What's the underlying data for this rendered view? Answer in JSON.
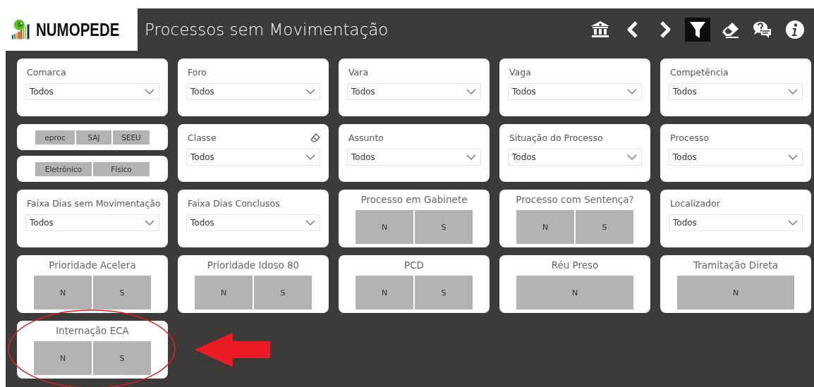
{
  "header": {
    "logo": "NUMOPEDE",
    "title": "Processos sem Movimentação",
    "toolbar": [
      {
        "kind": "bank",
        "selected": false
      },
      {
        "kind": "back",
        "selected": false
      },
      {
        "kind": "forward",
        "selected": false
      },
      {
        "kind": "filter",
        "selected": true
      },
      {
        "kind": "eraser",
        "selected": false
      },
      {
        "kind": "help",
        "selected": false
      },
      {
        "kind": "info",
        "selected": false
      }
    ]
  },
  "filters": [
    [
      {
        "kind": "dropdown",
        "label": "Comarca",
        "value": "Todos"
      },
      {
        "kind": "dropdown",
        "label": "Foro",
        "value": "Todos"
      },
      {
        "kind": "dropdown",
        "label": "Vara",
        "value": "Todos"
      },
      {
        "kind": "dropdown",
        "label": "Vaga",
        "value": "Todos"
      },
      {
        "kind": "dropdown",
        "label": "Competência",
        "value": "Todos"
      }
    ],
    [
      {
        "kind": "stack",
        "cards": [
          {
            "kind": "chips",
            "buttons": [
              {
                "label": "eproc",
                "selected": false
              },
              {
                "label": "SAJ",
                "selected": false
              },
              {
                "label": "SEEU",
                "selected": false
              }
            ]
          },
          {
            "kind": "chips",
            "buttons": [
              {
                "label": "Eletrônico",
                "selected": false
              },
              {
                "label": "Físico",
                "selected": false
              }
            ]
          }
        ]
      },
      {
        "kind": "dropdown",
        "label": "Classe",
        "value": "Todos",
        "eraser": true
      },
      {
        "kind": "dropdown",
        "label": "Assunto",
        "value": "Todos"
      },
      {
        "kind": "dropdown",
        "label": "Situação do Processo",
        "value": "Todos"
      },
      {
        "kind": "dropdown",
        "label": "Processo",
        "value": "Todos"
      }
    ],
    [
      {
        "kind": "dropdown",
        "label": "Faixa Dias sem Movimentação",
        "value": "Todos"
      },
      {
        "kind": "dropdown",
        "label": "Faixa Dias Conclusos",
        "value": "Todos"
      },
      {
        "kind": "buttons",
        "title": "Processo em Gabinete",
        "buttons": [
          {
            "label": "N",
            "selected": false
          },
          {
            "label": "S",
            "selected": false
          }
        ]
      },
      {
        "kind": "buttons",
        "title": "Processo com Sentença?",
        "buttons": [
          {
            "label": "N",
            "selected": false
          },
          {
            "label": "S",
            "selected": false
          }
        ]
      },
      {
        "kind": "dropdown",
        "label": "Localizador",
        "value": "Todos"
      }
    ],
    [
      {
        "kind": "buttons",
        "title": "Prioridade Acelera",
        "buttons": [
          {
            "label": "N",
            "selected": false
          },
          {
            "label": "S",
            "selected": false
          }
        ]
      },
      {
        "kind": "buttons",
        "title": "Prioridade Idoso 80",
        "buttons": [
          {
            "label": "N",
            "selected": false
          },
          {
            "label": "S",
            "selected": false
          }
        ]
      },
      {
        "kind": "buttons",
        "title": "PCD",
        "buttons": [
          {
            "label": "N",
            "selected": false
          },
          {
            "label": "S",
            "selected": false
          }
        ]
      },
      {
        "kind": "buttons",
        "title": "Réu Preso",
        "buttons": [
          {
            "label": "N",
            "selected": false
          }
        ]
      },
      {
        "kind": "buttons",
        "title": "Tramitação Direta",
        "buttons": [
          {
            "label": "N",
            "selected": false
          }
        ]
      }
    ],
    [
      {
        "kind": "buttons",
        "title": "Internação ECA",
        "buttons": [
          {
            "label": "N",
            "selected": false
          },
          {
            "label": "S",
            "selected": false
          }
        ]
      }
    ]
  ],
  "annotation": {
    "kind": "circle-and-arrow"
  }
}
